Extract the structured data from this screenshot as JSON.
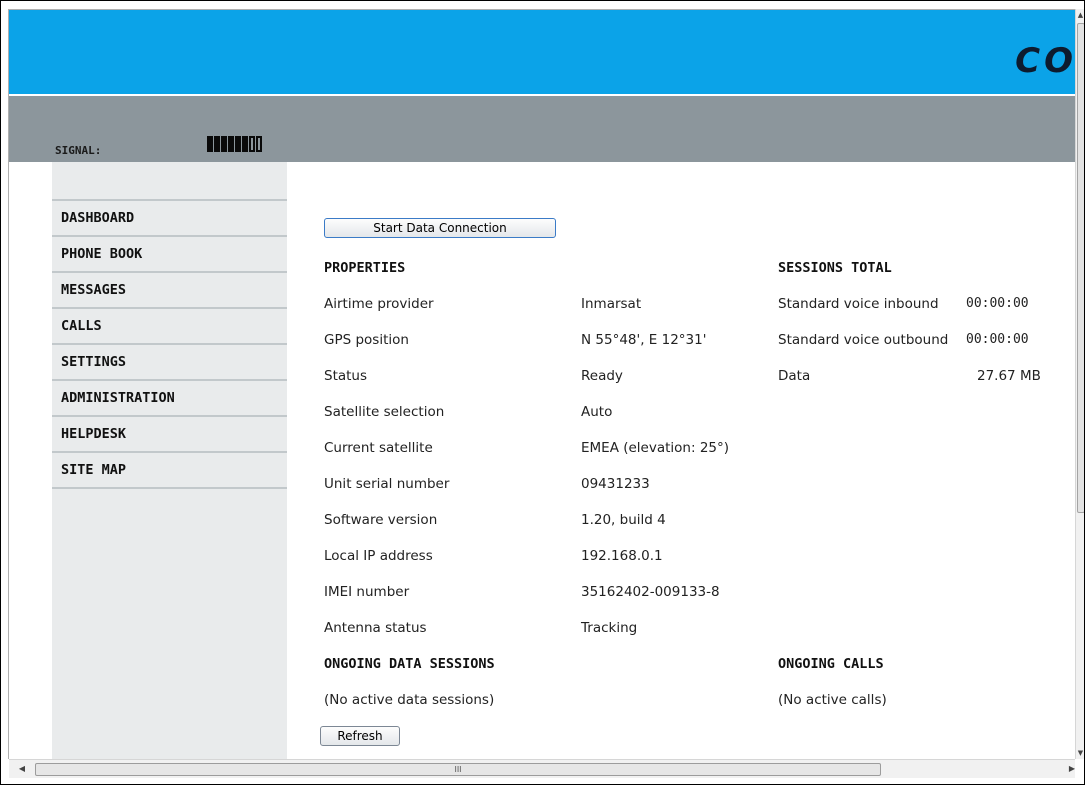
{
  "header": {
    "logo_text": "CO",
    "signal_label": "SIGNAL:",
    "signal_level": {
      "filled": 6,
      "total": 8
    }
  },
  "sidebar": {
    "items": [
      {
        "label": "DASHBOARD"
      },
      {
        "label": "PHONE BOOK"
      },
      {
        "label": "MESSAGES"
      },
      {
        "label": "CALLS"
      },
      {
        "label": "SETTINGS"
      },
      {
        "label": "ADMINISTRATION"
      },
      {
        "label": "HELPDESK"
      },
      {
        "label": "SITE MAP"
      }
    ]
  },
  "main": {
    "start_data_button": "Start Data Connection",
    "properties": {
      "heading": "PROPERTIES",
      "rows": [
        {
          "label": "Airtime provider",
          "value": "Inmarsat"
        },
        {
          "label": "GPS position",
          "value": "N 55°48', E 12°31'"
        },
        {
          "label": "Status",
          "value": "Ready"
        },
        {
          "label": "Satellite selection",
          "value": "Auto"
        },
        {
          "label": "Current satellite",
          "value": "EMEA (elevation: 25°)"
        },
        {
          "label": "Unit serial number",
          "value": "09431233"
        },
        {
          "label": "Software version",
          "value": "1.20, build 4"
        },
        {
          "label": "Local IP address",
          "value": "192.168.0.1"
        },
        {
          "label": "IMEI number",
          "value": "35162402-009133-8"
        },
        {
          "label": "Antenna status",
          "value": "Tracking"
        }
      ]
    },
    "sessions_total": {
      "heading": "SESSIONS TOTAL",
      "rows": [
        {
          "label": "Standard voice inbound",
          "value": "00:00:00"
        },
        {
          "label": "Standard voice outbound",
          "value": "00:00:00"
        },
        {
          "label": "Data",
          "value": "27.67 MB"
        }
      ]
    },
    "ongoing_data_sessions": {
      "heading": "ONGOING DATA SESSIONS",
      "text": "(No active data sessions)"
    },
    "ongoing_calls": {
      "heading": "ONGOING CALLS",
      "text": "(No active calls)"
    },
    "refresh_button": "Refresh"
  },
  "scrollbar": {
    "hgrip": "III"
  }
}
